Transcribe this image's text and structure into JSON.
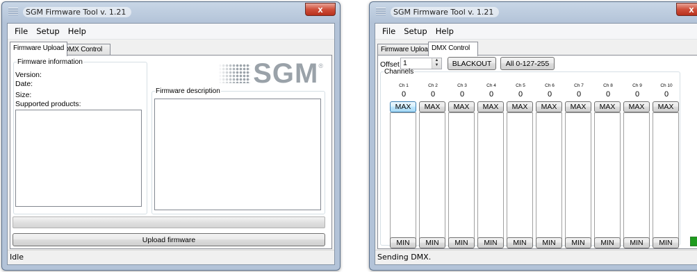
{
  "window1": {
    "title": "SGM Firmware Tool v. 1.21",
    "close_glyph": "x",
    "menu": [
      "File",
      "Setup",
      "Help"
    ],
    "tabs": [
      "Firmware Upload",
      "DMX Control"
    ],
    "active_tab": "Firmware Upload",
    "firmware_info": {
      "legend": "Firmware information",
      "version_label": "Version:",
      "date_label": "Date:",
      "size_label": "Size:",
      "supported_label": "Supported products:"
    },
    "logo_text": "SGM",
    "logo_reg": "®",
    "description_legend": "Firmware description",
    "progress": 0,
    "upload_button": "Upload firmware",
    "status": "Idle"
  },
  "window2": {
    "title": "SGM Firmware Tool v. 1.21",
    "close_glyph": "x",
    "menu": [
      "File",
      "Setup",
      "Help"
    ],
    "tabs": [
      "Firmware Upload",
      "DMX Control"
    ],
    "active_tab": "DMX Control",
    "offset_label": "Offset",
    "offset_value": "1",
    "blackout_button": "BLACKOUT",
    "all_button": "All 0-127-255",
    "channels_legend": "Channels",
    "channels": [
      {
        "label": "Ch 1",
        "value": "0",
        "max": "MAX",
        "min": "MIN"
      },
      {
        "label": "Ch 2",
        "value": "0",
        "max": "MAX",
        "min": "MIN"
      },
      {
        "label": "Ch 3",
        "value": "0",
        "max": "MAX",
        "min": "MIN"
      },
      {
        "label": "Ch 4",
        "value": "0",
        "max": "MAX",
        "min": "MIN"
      },
      {
        "label": "Ch 5",
        "value": "0",
        "max": "MAX",
        "min": "MIN"
      },
      {
        "label": "Ch 6",
        "value": "0",
        "max": "MAX",
        "min": "MIN"
      },
      {
        "label": "Ch 7",
        "value": "0",
        "max": "MAX",
        "min": "MIN"
      },
      {
        "label": "Ch 8",
        "value": "0",
        "max": "MAX",
        "min": "MIN"
      },
      {
        "label": "Ch 9",
        "value": "0",
        "max": "MAX",
        "min": "MIN"
      },
      {
        "label": "Ch 10",
        "value": "0",
        "max": "MAX",
        "min": "MIN"
      }
    ],
    "indicator_color": "#1e9b1e",
    "status": "Sending DMX."
  }
}
